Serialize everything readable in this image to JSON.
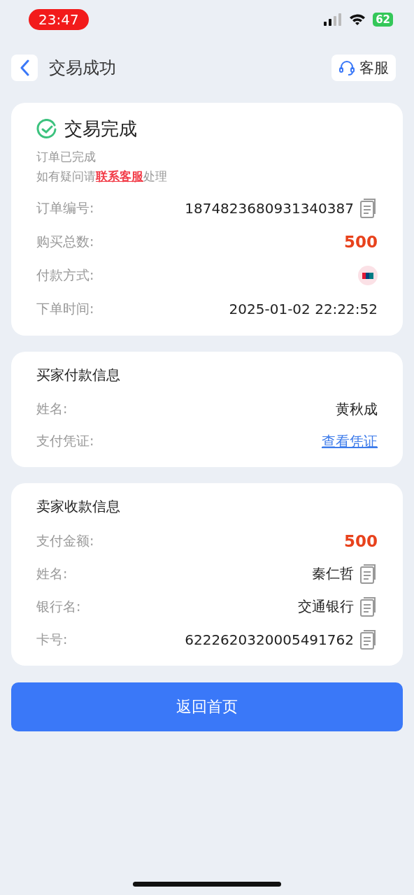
{
  "status_bar": {
    "time": "23:47",
    "battery": "62"
  },
  "header": {
    "title": "交易成功",
    "service_button": "客服"
  },
  "status_card": {
    "title": "交易完成",
    "line_1": "订单已完成",
    "line_2_prefix": "如有疑问请",
    "line_2_link": "联系客服",
    "line_2_suffix": "处理",
    "rows": [
      {
        "label": "订单编号:",
        "value": "1874823680931340387",
        "kind": "text",
        "copyable": true
      },
      {
        "label": "购买总数:",
        "value": "500",
        "kind": "amount",
        "copyable": false
      },
      {
        "label": "付款方式:",
        "kind": "payment",
        "copyable": false
      },
      {
        "label": "下单时间:",
        "value": "2025-01-02 22:22:52",
        "kind": "text",
        "copyable": false
      }
    ]
  },
  "buyer_card": {
    "title": "买家付款信息",
    "rows": [
      {
        "label": "姓名:",
        "value": "黄秋成",
        "kind": "text",
        "copyable": false
      },
      {
        "label": "支付凭证:",
        "value": "查看凭证",
        "kind": "link",
        "copyable": false
      }
    ]
  },
  "seller_card": {
    "title": "卖家收款信息",
    "rows": [
      {
        "label": "支付金额:",
        "value": "500",
        "kind": "amount",
        "copyable": false
      },
      {
        "label": "姓名:",
        "value": "秦仁哲",
        "kind": "text",
        "copyable": true
      },
      {
        "label": "银行名:",
        "value": "交通银行",
        "kind": "text",
        "copyable": true
      },
      {
        "label": "卡号:",
        "value": "6222620320005491762",
        "kind": "text",
        "copyable": true
      }
    ]
  },
  "primary_button": "返回首页"
}
